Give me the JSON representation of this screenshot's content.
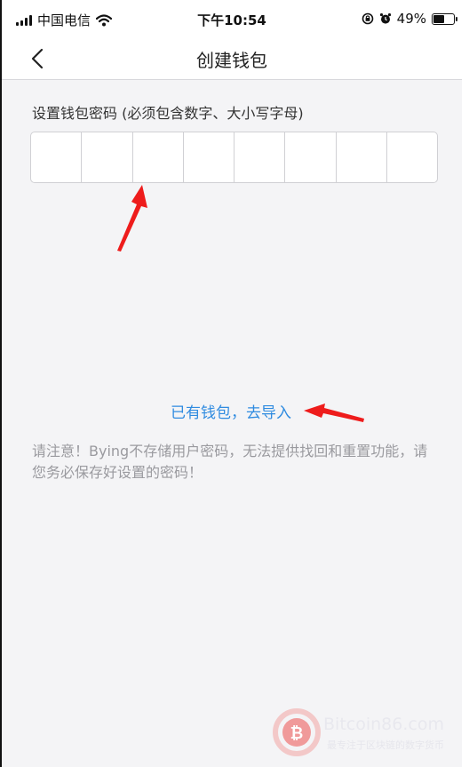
{
  "status_bar": {
    "carrier": "中国电信",
    "time": "下午10:54",
    "battery": "49%",
    "battery_level": 0.49
  },
  "nav": {
    "title": "创建钱包",
    "back_icon": "chevron-left-icon"
  },
  "form": {
    "password_label": "设置钱包密码 (必须包含数字、大小写字母)",
    "password_cells": 8
  },
  "import_link": "已有钱包，去导入",
  "notice": "请注意！Bying不存储用户密码，无法提供找回和重置功能，请您务必保存好设置的密码！",
  "watermark": {
    "title": "Bitcoin86.com",
    "subtitle": "最专注于区块链的数字货币"
  },
  "colors": {
    "accent": "#2f8be0",
    "annotation": "#ee1c1c",
    "background": "#f4f4f6"
  }
}
